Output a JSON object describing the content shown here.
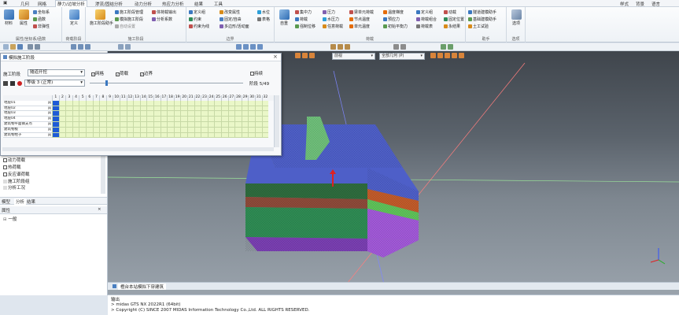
{
  "menu": {
    "items": [
      "几何",
      "网格",
      "静力/边坡分析",
      "渗流/固结分析",
      "动力分析",
      "热应力分析",
      "结果",
      "工具"
    ],
    "active_index": 2,
    "right": [
      "样式",
      "背景",
      "语言"
    ]
  },
  "ribbon": {
    "groups": [
      {
        "label": "属性/坐标系/函数",
        "big": [
          {
            "label": "材料"
          },
          {
            "label": "属性"
          }
        ],
        "small": [
          "坐标系",
          "函数",
          "非弹性"
        ]
      },
      {
        "label": "荷载阶段",
        "big": [
          {
            "label": "定义"
          }
        ],
        "small": []
      },
      {
        "label": "施工阶段",
        "big": [
          {
            "label": "施工阶段助手"
          }
        ],
        "small": [
          "施工阶段管理",
          "模拟施工阶段",
          "自动设置",
          "体荷载输出",
          "分析系数"
        ]
      },
      {
        "label": "边界",
        "big": [],
        "small": [
          "定义组",
          "约束",
          "约束为线",
          "改变属性",
          "固定/自由",
          "多边形/活动面",
          "水位",
          "表格"
        ]
      },
      {
        "label": "荷载",
        "big": [
          {
            "label": "自重"
          }
        ],
        "small": [
          "集中力",
          "荷载",
          "强制位移",
          "压力",
          "水压力",
          "任意荷载",
          "梁单元荷载",
          "节点温度",
          "单元温度",
          "温度梯度",
          "预应力",
          "初始平衡力",
          "定义组",
          "荷载组合",
          "荷载表",
          "动载",
          "固定位置",
          "永结果"
        ]
      },
      {
        "label": "助手",
        "big": [],
        "small": [
          "隧道建模助手",
          "基础建模助手",
          "土工试验"
        ]
      },
      {
        "label": "选项",
        "big": [
          {
            "label": "选项"
          }
        ],
        "small": []
      }
    ]
  },
  "dialog": {
    "title": "模拟施工阶段",
    "stage_label": "施工阶段",
    "stage_value": "隧道开挖",
    "checks": [
      {
        "label": "网格",
        "checked": true
      },
      {
        "label": "荷载",
        "checked": true
      },
      {
        "label": "边界",
        "checked": true
      },
      {
        "label": "持续",
        "checked": false
      }
    ],
    "level_value": "等级 3 (正常)",
    "stage_counter": "阶段 5/49",
    "column_numbers": [
      "1",
      "2",
      "3",
      "4",
      "5",
      "6",
      "7",
      "8",
      "9",
      "10",
      "11",
      "12",
      "13",
      "14",
      "15",
      "16",
      "17",
      "18",
      "19",
      "20",
      "21",
      "22",
      "23",
      "24",
      "25",
      "26",
      "27",
      "28",
      "29",
      "30",
      "31",
      "32"
    ],
    "rows": [
      "地层01",
      "地层02",
      "地层03",
      "地层04",
      "建筑物平面钢支点",
      "建筑物板",
      "建筑物柱子"
    ],
    "row_flag": "M",
    "colors": {
      "active": "#1e5bd6",
      "fill": "#eaf7c8",
      "header": "#f1f3f6"
    }
  },
  "left_panel": {
    "tree": [
      {
        "label": "荷载",
        "checked": true
      },
      {
        "label": "动力荷载",
        "checked": true
      },
      {
        "label": "热荷载",
        "checked": true
      },
      {
        "label": "反应谱荷载",
        "checked": true
      },
      {
        "label": "施工阶段组",
        "checked": false
      },
      {
        "label": "分析工况",
        "checked": false
      }
    ],
    "tabs": [
      "模型",
      "分析",
      "结果"
    ],
    "props_title": "属性",
    "props_sub": "一般"
  },
  "viewport": {
    "view_select": "前视",
    "view_select_2": "全部几何 (P)",
    "doc_tab": "橙台本站模拟下穿建筑"
  },
  "console": {
    "title": "输出",
    "lines": [
      "> midas GTS NX 2022R1 (64bit)",
      "> Copyright (C) SINCE 2007 MIDAS Information Technology Co.,Ltd. ALL RIGHTS RESERVED."
    ]
  }
}
